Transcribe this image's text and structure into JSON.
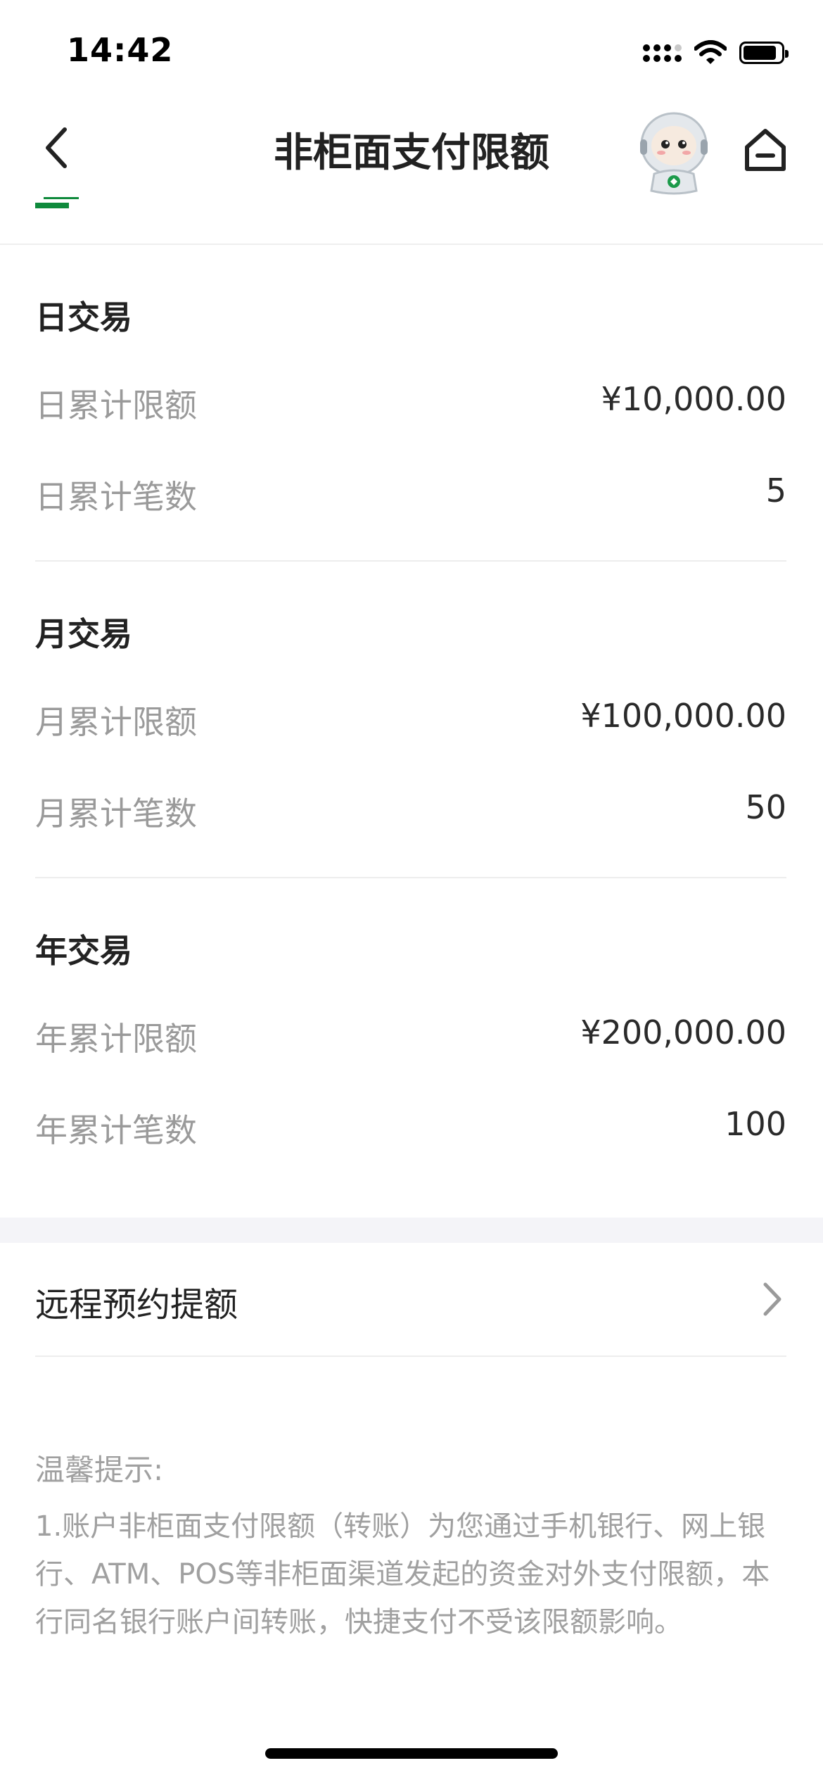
{
  "status_bar": {
    "time": "14:42",
    "battery_level": 0.88
  },
  "nav": {
    "title": "非柜面支付限额",
    "back_icon": "chevron-left-icon",
    "mascot_icon": "astronaut-mascot-icon",
    "home_icon": "home-icon"
  },
  "limits": {
    "daily": {
      "title": "日交易",
      "amount_label": "日累计限额",
      "amount_value": "¥10,000.00",
      "count_label": "日累计笔数",
      "count_value": "5"
    },
    "monthly": {
      "title": "月交易",
      "amount_label": "月累计限额",
      "amount_value": "¥100,000.00",
      "count_label": "月累计笔数",
      "count_value": "50"
    },
    "yearly": {
      "title": "年交易",
      "amount_label": "年累计限额",
      "amount_value": "¥200,000.00",
      "count_label": "年累计笔数",
      "count_value": "100"
    }
  },
  "remote_limit": {
    "label": "远程预约提额",
    "chevron_icon": "chevron-right-icon"
  },
  "tips": {
    "title": "温馨提示:",
    "item1": "1.账户非柜面支付限额（转账）为您通过手机银行、网上银行、ATM、POS等非柜面渠道发起的资金对外支付限额，本行同名银行账户间转账，快捷支付不受该限额影响。"
  },
  "colors": {
    "brand_green": "#0f8a3c",
    "label_gray": "#9a9a9a",
    "band_gray": "#f4f4f8"
  }
}
